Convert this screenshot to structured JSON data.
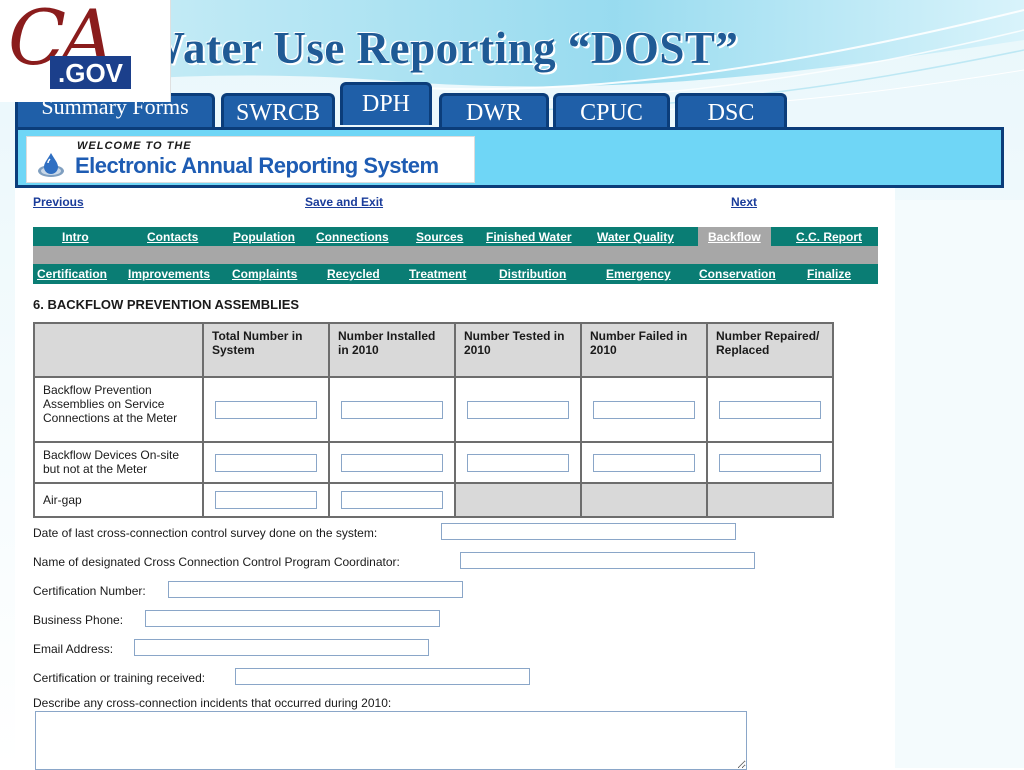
{
  "brand": {
    "logo_ca": "CA",
    "logo_gov": ".GOV"
  },
  "slide_title": "Water Use Reporting “DOST”",
  "top_tabs": [
    {
      "label": "Summary Forms"
    },
    {
      "label": "SWRCB"
    },
    {
      "label": "DPH"
    },
    {
      "label": "DWR"
    },
    {
      "label": "CPUC"
    },
    {
      "label": "DSC"
    }
  ],
  "active_tab": "DPH",
  "banner": {
    "small": "WELCOME TO THE",
    "main": "Electronic Annual Reporting System"
  },
  "nav": {
    "previous": "Previous",
    "save_exit": "Save and Exit",
    "next": "Next"
  },
  "section_tabs_row1": [
    "Intro",
    "Contacts",
    "Population",
    "Connections",
    "Sources",
    "Finished Water",
    "Water Quality",
    "Backflow",
    "C.C. Report"
  ],
  "section_tabs_row2": [
    "Certification",
    "Improvements",
    "Complaints",
    "Recycled",
    "Treatment",
    "Distribution",
    "Emergency",
    "Conservation",
    "Finalize"
  ],
  "current_section": "Backflow",
  "section_title": "6. BACKFLOW PREVENTION ASSEMBLIES",
  "table": {
    "headers": [
      "",
      "Total Number in System",
      "Number Installed in 2010",
      "Number Tested in 2010",
      "Number Failed in 2010",
      "Number Repaired/ Replaced"
    ],
    "rows": [
      {
        "label": "Backflow Prevention Assemblies on Service Connections at the Meter",
        "inputs": 5
      },
      {
        "label": "Backflow Devices On-site but not at the Meter",
        "inputs": 5
      },
      {
        "label": "Air-gap",
        "inputs": 2
      }
    ]
  },
  "fields": {
    "survey_date": "Date of last cross-connection control survey done on the system:",
    "coordinator_name": "Name of designated Cross Connection Control Program Coordinator:",
    "cert_number": "Certification Number:",
    "business_phone": "Business Phone:",
    "email": "Email Address:",
    "training": "Certification or training received:",
    "incidents": "Describe any cross-connection incidents that occurred during 2010:"
  },
  "colors": {
    "title_blue": "#1f5a95",
    "tab_blue": "#1f5fa8",
    "panel_cyan": "#6fd6f6",
    "teal_bar": "#0a7d74",
    "link_blue": "#1a3c9a"
  }
}
